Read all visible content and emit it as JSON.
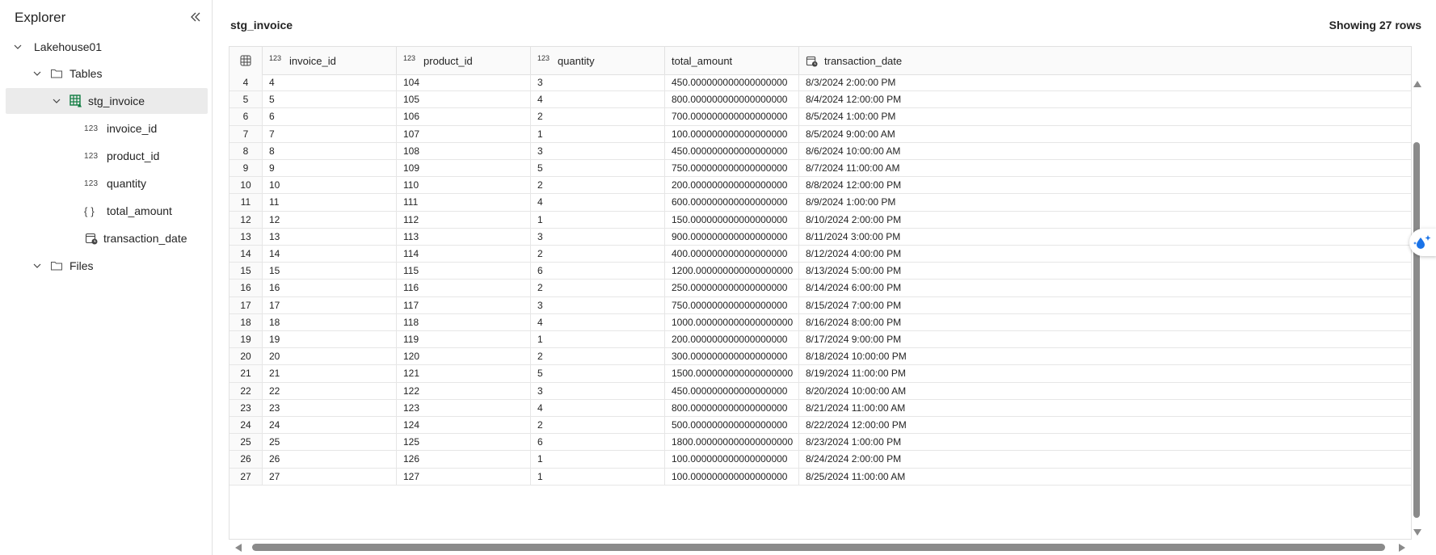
{
  "explorer": {
    "title": "Explorer",
    "lakehouse": "Lakehouse01",
    "tables_label": "Tables",
    "table_name": "stg_invoice",
    "columns": [
      {
        "type_label": "123",
        "name": "invoice_id"
      },
      {
        "type_label": "123",
        "name": "product_id"
      },
      {
        "type_label": "123",
        "name": "quantity"
      },
      {
        "type_label": "{ }",
        "name": "total_amount"
      },
      {
        "type_label": "",
        "name": "transaction_date"
      }
    ],
    "files_label": "Files"
  },
  "preview": {
    "table_name": "stg_invoice",
    "row_count_text": "Showing 27 rows",
    "headers": [
      {
        "type_label": "123",
        "name": "invoice_id"
      },
      {
        "type_label": "123",
        "name": "product_id"
      },
      {
        "type_label": "123",
        "name": "quantity"
      },
      {
        "type_label": "",
        "name": "total_amount"
      },
      {
        "type_label": "",
        "name": "transaction_date"
      }
    ],
    "rows": [
      [
        "4",
        "4",
        "104",
        "3",
        "450.000000000000000000",
        "8/3/2024 2:00:00 PM"
      ],
      [
        "5",
        "5",
        "105",
        "4",
        "800.000000000000000000",
        "8/4/2024 12:00:00 PM"
      ],
      [
        "6",
        "6",
        "106",
        "2",
        "700.000000000000000000",
        "8/5/2024 1:00:00 PM"
      ],
      [
        "7",
        "7",
        "107",
        "1",
        "100.000000000000000000",
        "8/5/2024 9:00:00 AM"
      ],
      [
        "8",
        "8",
        "108",
        "3",
        "450.000000000000000000",
        "8/6/2024 10:00:00 AM"
      ],
      [
        "9",
        "9",
        "109",
        "5",
        "750.000000000000000000",
        "8/7/2024 11:00:00 AM"
      ],
      [
        "10",
        "10",
        "110",
        "2",
        "200.000000000000000000",
        "8/8/2024 12:00:00 PM"
      ],
      [
        "11",
        "11",
        "111",
        "4",
        "600.000000000000000000",
        "8/9/2024 1:00:00 PM"
      ],
      [
        "12",
        "12",
        "112",
        "1",
        "150.000000000000000000",
        "8/10/2024 2:00:00 PM"
      ],
      [
        "13",
        "13",
        "113",
        "3",
        "900.000000000000000000",
        "8/11/2024 3:00:00 PM"
      ],
      [
        "14",
        "14",
        "114",
        "2",
        "400.000000000000000000",
        "8/12/2024 4:00:00 PM"
      ],
      [
        "15",
        "15",
        "115",
        "6",
        "1200.000000000000000000",
        "8/13/2024 5:00:00 PM"
      ],
      [
        "16",
        "16",
        "116",
        "2",
        "250.000000000000000000",
        "8/14/2024 6:00:00 PM"
      ],
      [
        "17",
        "17",
        "117",
        "3",
        "750.000000000000000000",
        "8/15/2024 7:00:00 PM"
      ],
      [
        "18",
        "18",
        "118",
        "4",
        "1000.000000000000000000",
        "8/16/2024 8:00:00 PM"
      ],
      [
        "19",
        "19",
        "119",
        "1",
        "200.000000000000000000",
        "8/17/2024 9:00:00 PM"
      ],
      [
        "20",
        "20",
        "120",
        "2",
        "300.000000000000000000",
        "8/18/2024 10:00:00 PM"
      ],
      [
        "21",
        "21",
        "121",
        "5",
        "1500.000000000000000000",
        "8/19/2024 11:00:00 PM"
      ],
      [
        "22",
        "22",
        "122",
        "3",
        "450.000000000000000000",
        "8/20/2024 10:00:00 AM"
      ],
      [
        "23",
        "23",
        "123",
        "4",
        "800.000000000000000000",
        "8/21/2024 11:00:00 AM"
      ],
      [
        "24",
        "24",
        "124",
        "2",
        "500.000000000000000000",
        "8/22/2024 12:00:00 PM"
      ],
      [
        "25",
        "25",
        "125",
        "6",
        "1800.000000000000000000",
        "8/23/2024 1:00:00 PM"
      ],
      [
        "26",
        "26",
        "126",
        "1",
        "100.000000000000000000",
        "8/24/2024 2:00:00 PM"
      ],
      [
        "27",
        "27",
        "127",
        "1",
        "100.000000000000000000",
        "8/25/2024 11:00:00 AM"
      ]
    ]
  },
  "colors": {
    "accent_green": "#107c41",
    "copilot_blue": "#1a73e8",
    "scrollbar": "#8a8a8a"
  }
}
